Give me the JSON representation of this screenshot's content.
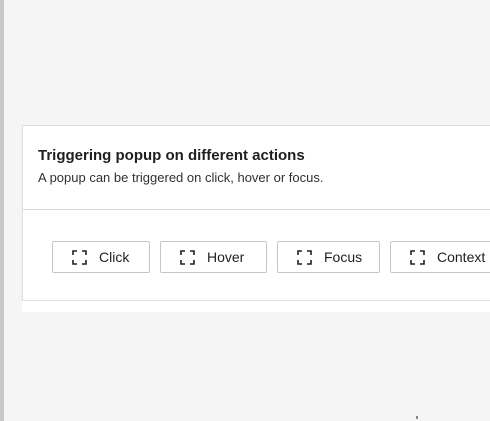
{
  "card": {
    "title": "Triggering popup on different actions",
    "description": "A popup can be triggered on click, hover or focus."
  },
  "buttons": [
    {
      "label": "Click",
      "icon": "expand-icon"
    },
    {
      "label": "Hover",
      "icon": "expand-icon"
    },
    {
      "label": "Focus",
      "icon": "expand-icon"
    },
    {
      "label": "Context",
      "icon": "expand-icon"
    }
  ],
  "colors": {
    "page_background": "#f5f5f5",
    "card_background": "#ffffff",
    "border": "#c8c6c4",
    "text": "#201f1e"
  }
}
